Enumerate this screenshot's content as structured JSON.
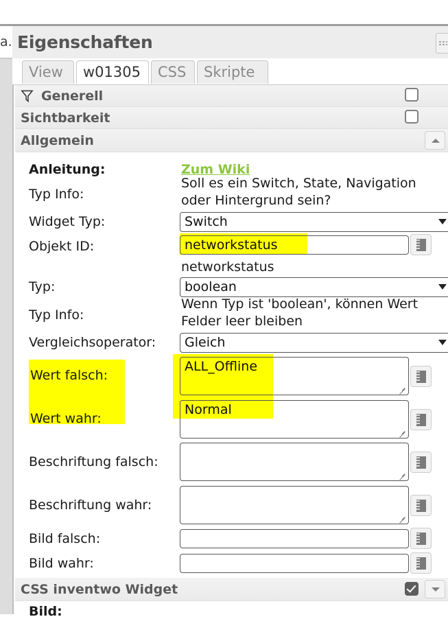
{
  "neighbor_panel": {
    "clipped_text": "a."
  },
  "window": {
    "title": "Eigenschaften",
    "corner_button": "grip-handle"
  },
  "tabs": [
    {
      "label": "View",
      "active": false
    },
    {
      "label": "w01305",
      "active": true
    },
    {
      "label": "CSS",
      "active": false
    },
    {
      "label": "Skripte",
      "active": false
    }
  ],
  "sections": [
    {
      "name": "Generell",
      "icon": "filter-icon",
      "checkbox": false,
      "collapse": null
    },
    {
      "name": "Sichtbarkeit",
      "icon": null,
      "checkbox": false,
      "collapse": null
    },
    {
      "name": "Allgemein",
      "icon": null,
      "checkbox": null,
      "collapse": "up"
    },
    {
      "name": "CSS inventwo Widget",
      "icon": null,
      "checkbox": true,
      "collapse": "down"
    }
  ],
  "form": {
    "anleitung": {
      "label": "Anleitung:",
      "link": "Zum Wiki"
    },
    "typinfo1": {
      "label": "Typ Info:",
      "text_line1": "Soll es ein Switch, State, Navigation",
      "text_line2": "oder Hintergrund sein?"
    },
    "widget_typ": {
      "label": "Widget Typ:",
      "value": "Switch",
      "control": "select"
    },
    "objekt_id": {
      "label": "Objekt ID:",
      "value": "networkstatus",
      "control": "input",
      "highlighted": true,
      "subtext": "networkstatus"
    },
    "typ": {
      "label": "Typ:",
      "value": "boolean",
      "control": "select"
    },
    "typinfo2": {
      "label": "Typ Info:",
      "text_line1": "Wenn Typ ist 'boolean', können Wert",
      "text_line2": "Felder leer bleiben"
    },
    "vergleichsoperator": {
      "label": "Vergleichsoperator:",
      "value": "Gleich",
      "control": "select"
    },
    "wert_falsch": {
      "label": "Wert falsch:",
      "value": "ALL_Offline",
      "control": "textarea",
      "highlighted": true
    },
    "wert_wahr": {
      "label": "Wert wahr:",
      "value": "Normal",
      "control": "textarea",
      "highlighted": true
    },
    "beschriftung_falsch": {
      "label": "Beschriftung falsch:",
      "value": "",
      "control": "textarea"
    },
    "beschriftung_wahr": {
      "label": "Beschriftung wahr:",
      "value": "",
      "control": "textarea"
    },
    "bild_falsch": {
      "label": "Bild falsch:",
      "value": "",
      "control": "input"
    },
    "bild_wahr": {
      "label": "Bild wahr:",
      "value": "",
      "control": "input"
    },
    "bild_css": {
      "label": "Bild:"
    }
  },
  "colors": {
    "highlight": "#ffff00",
    "wiki_link": "#8CC63F",
    "section_bg": "#eeeeee",
    "panel_bg": "#ffffff",
    "header_bg": "#ededed"
  }
}
